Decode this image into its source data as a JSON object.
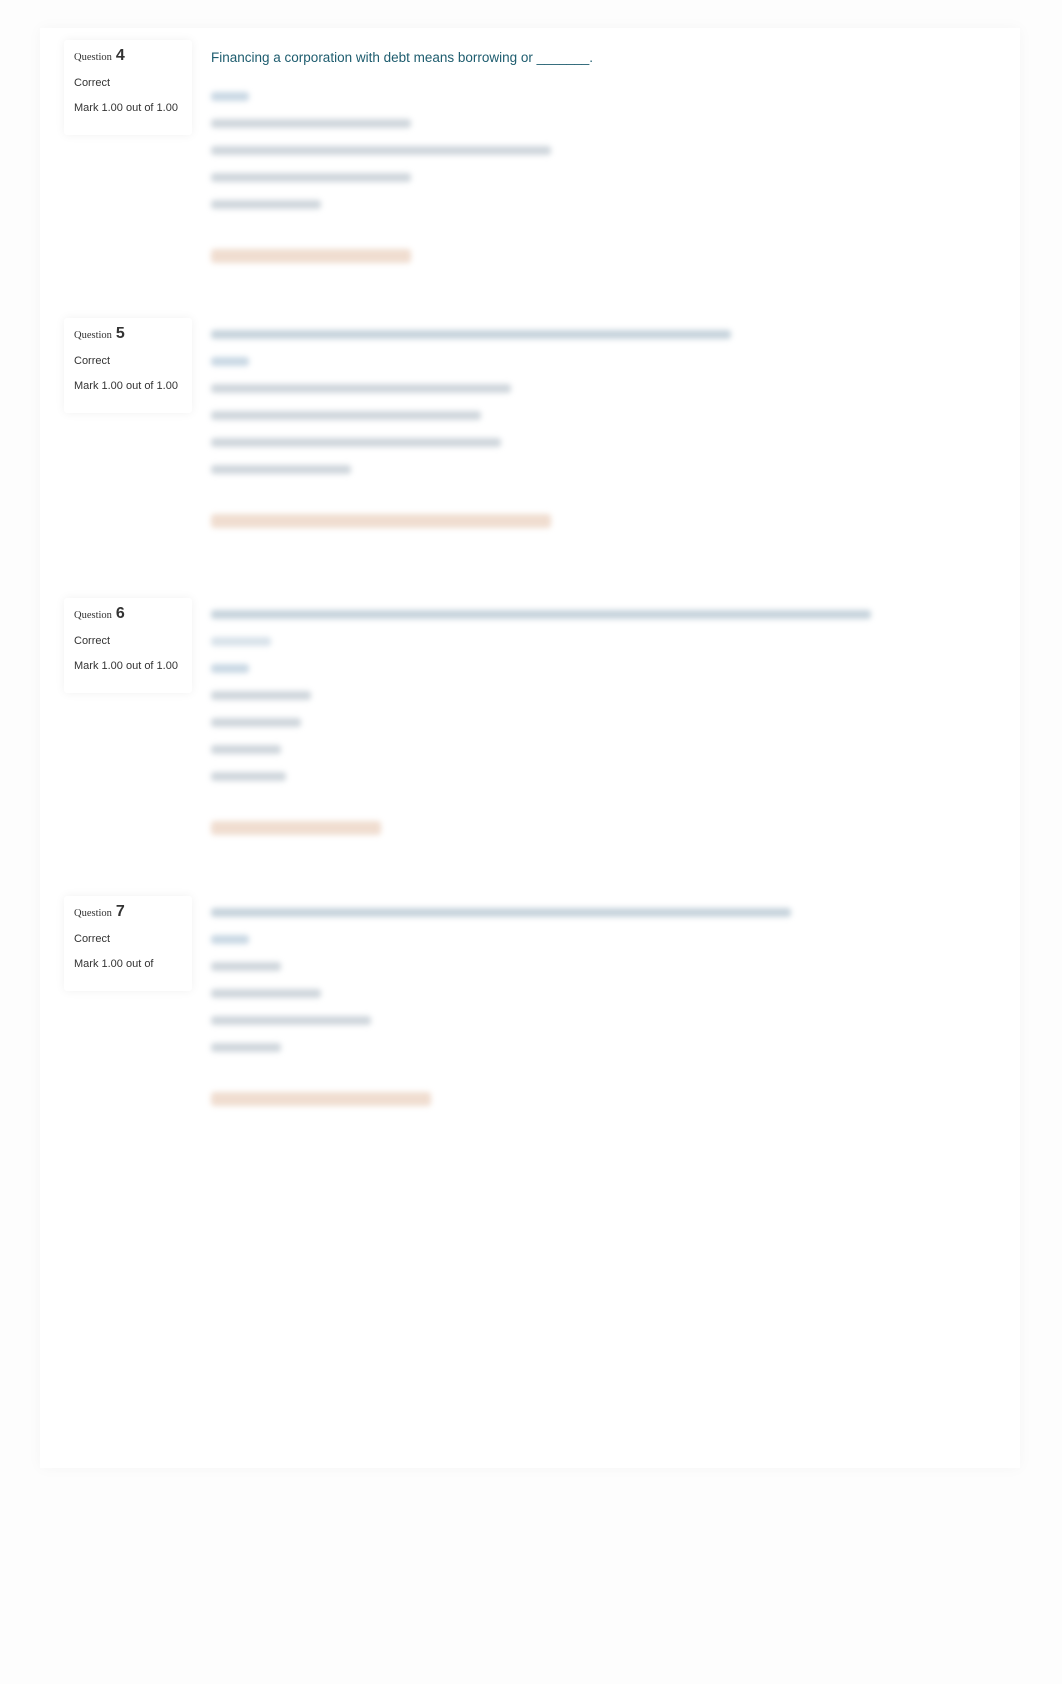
{
  "questions": [
    {
      "label": "Question",
      "number": "4",
      "state": "Correct",
      "mark": "Mark 1.00 out of 1.00",
      "text": "Financing a corporation with debt means borrowing or _______."
    },
    {
      "label": "Question",
      "number": "5",
      "state": "Correct",
      "mark": "Mark 1.00 out of 1.00"
    },
    {
      "label": "Question",
      "number": "6",
      "state": "Correct",
      "mark": "Mark 1.00 out of 1.00"
    },
    {
      "label": "Question",
      "number": "7",
      "state": "Correct",
      "mark": "Mark 1.00 out of"
    }
  ],
  "colors": {
    "question_text": "#1d5c6e",
    "feedback": "#f0ddd0"
  }
}
